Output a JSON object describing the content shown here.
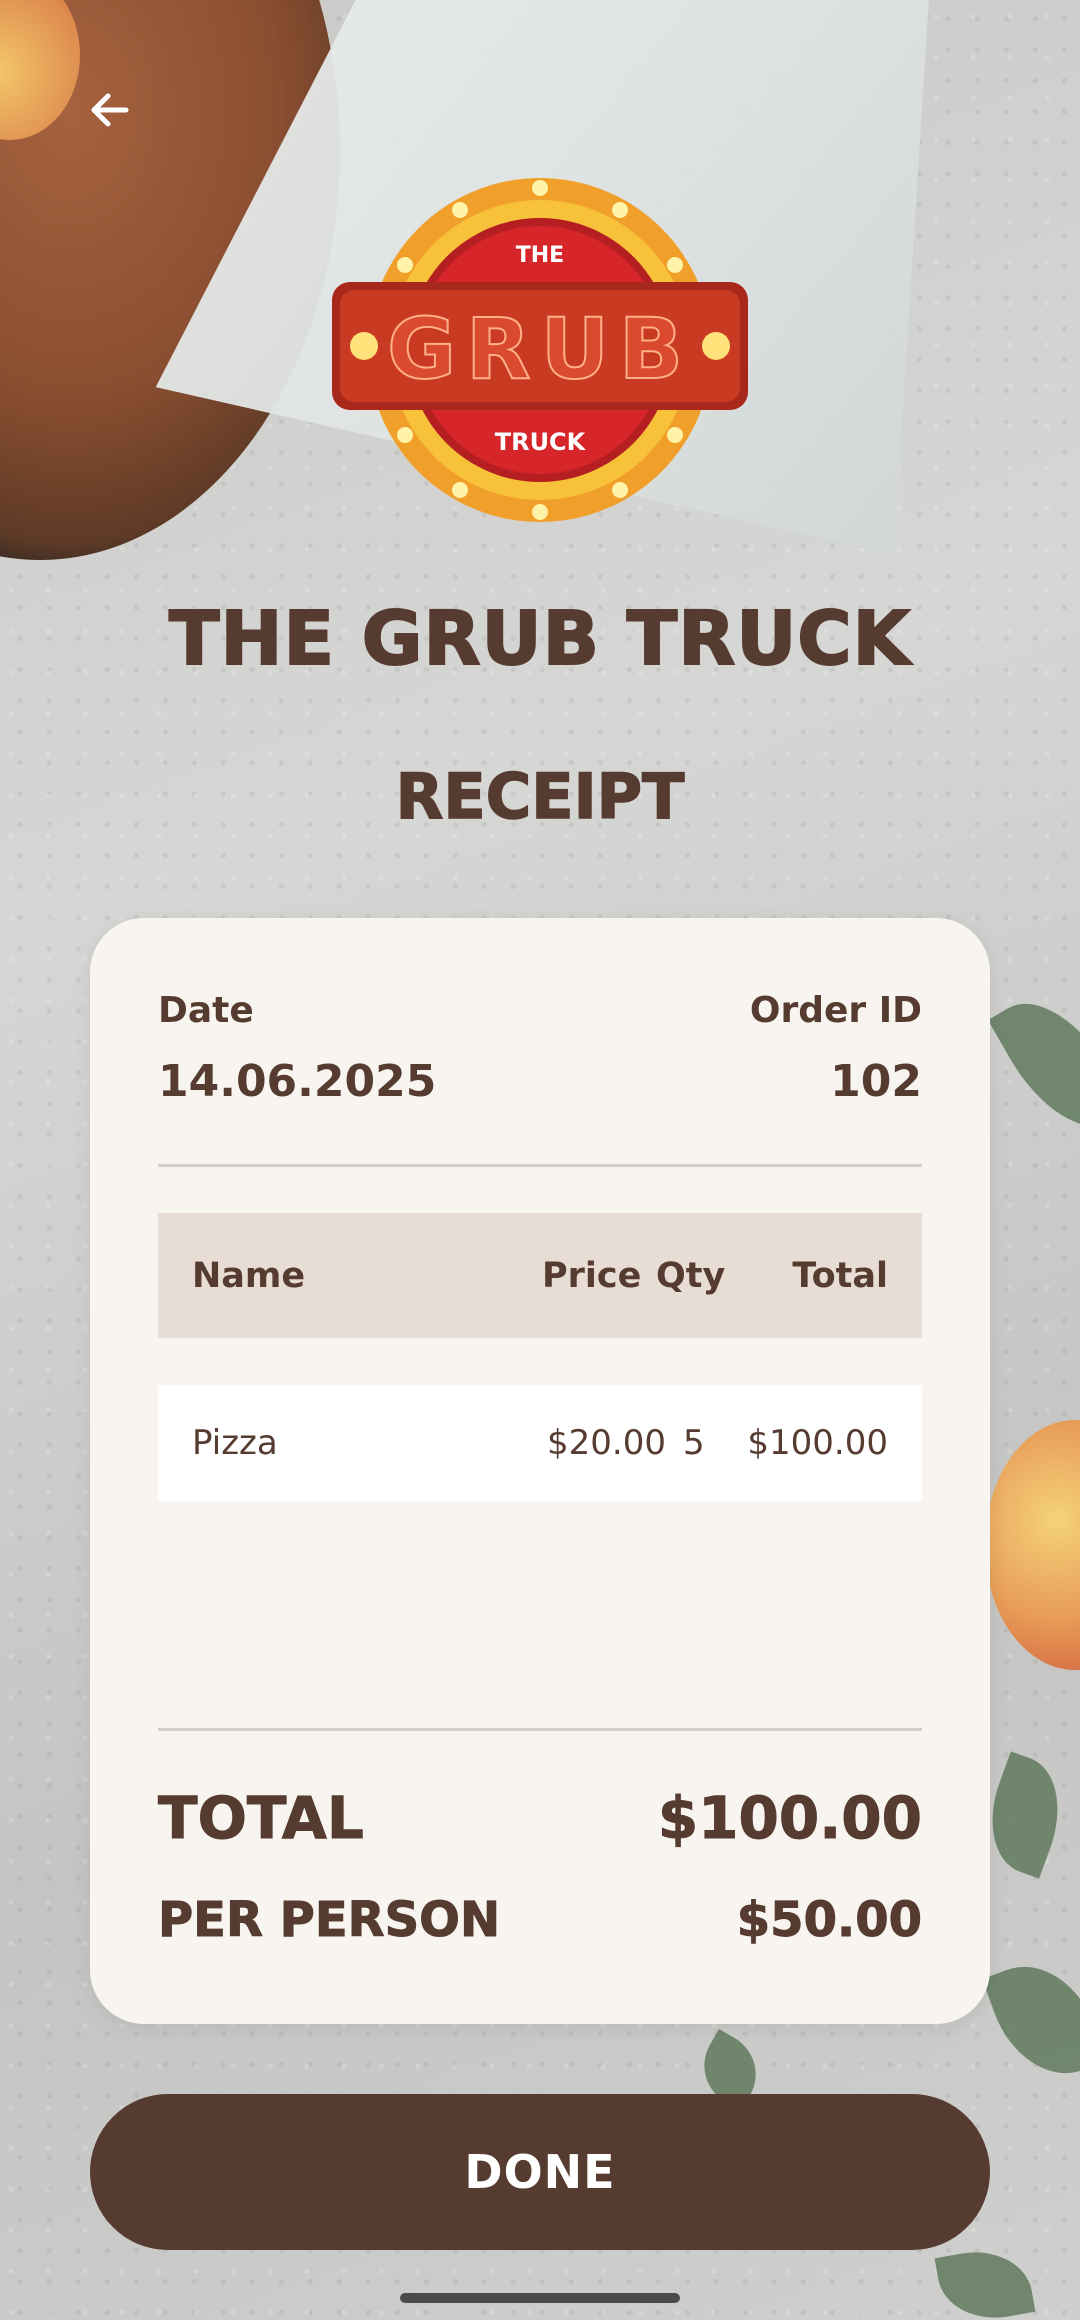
{
  "header": {
    "back_icon": "arrow-left-icon",
    "logo": {
      "top_text": "THE",
      "main_text": "GRUB",
      "bottom_text": "TRUCK",
      "colors": {
        "ring": "#f0a02a",
        "center": "#d6262a",
        "banner": "#a8281c"
      }
    },
    "brand_name": "THE GRUB TRUCK",
    "subtitle": "RECEIPT"
  },
  "receipt": {
    "date_label": "Date",
    "date_value": "14.06.2025",
    "order_label": "Order ID",
    "order_value": "102",
    "table": {
      "headers": {
        "name": "Name",
        "price": "Price",
        "qty": "Qty",
        "total": "Total"
      },
      "rows": [
        {
          "name": "Pizza",
          "price": "$20.00",
          "qty": "5",
          "total": "$100.00"
        }
      ]
    },
    "total_label": "TOTAL",
    "total_value": "$100.00",
    "per_person_label": "PER PERSON",
    "per_person_value": "$50.00"
  },
  "actions": {
    "done_label": "DONE"
  },
  "colors": {
    "brown": "#563b30",
    "card_bg": "#f8f5f1",
    "table_header_bg": "#e7ddd5"
  }
}
